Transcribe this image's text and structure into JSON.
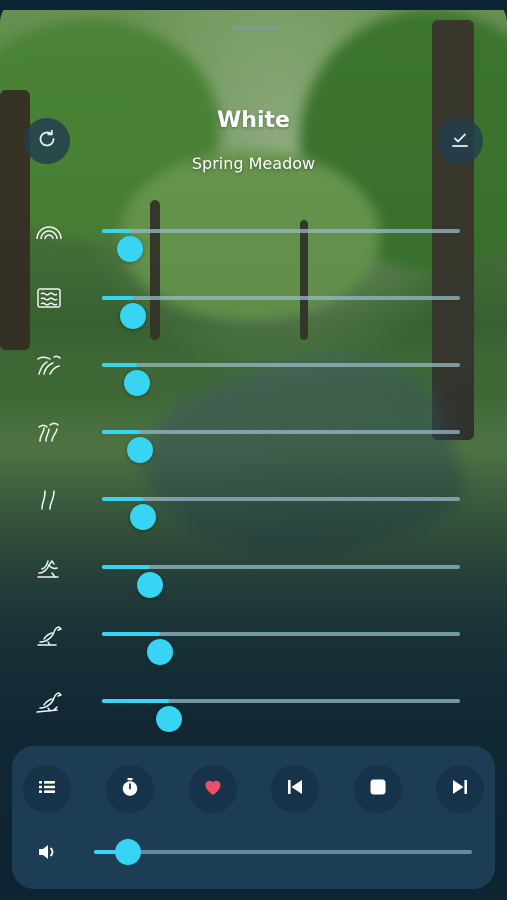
{
  "header": {
    "title": "White",
    "subtitle": "Spring Meadow",
    "reset_icon": "refresh-icon",
    "confirm_icon": "check-icon"
  },
  "sounds": [
    {
      "icon": "rainbow-icon",
      "level": 0.04
    },
    {
      "icon": "waves-box-icon",
      "level": 0.05
    },
    {
      "icon": "grass-wind-icon",
      "level": 0.06
    },
    {
      "icon": "rapids-icon",
      "level": 0.07
    },
    {
      "icon": "stream-icon",
      "level": 0.08
    },
    {
      "icon": "birds-flock-icon",
      "level": 0.1
    },
    {
      "icon": "songbird-icon",
      "level": 0.13
    },
    {
      "icon": "songbird-branch-icon",
      "level": 0.16
    }
  ],
  "player": {
    "controls": [
      "list-icon",
      "timer-icon",
      "heart-icon",
      "previous-icon",
      "stop-icon",
      "next-icon"
    ],
    "volume": 0.06,
    "volume_icon": "speaker-icon"
  },
  "colors": {
    "accent": "#37d4f4",
    "favorite": "#ee4f68",
    "panel": "#1c3d54"
  }
}
